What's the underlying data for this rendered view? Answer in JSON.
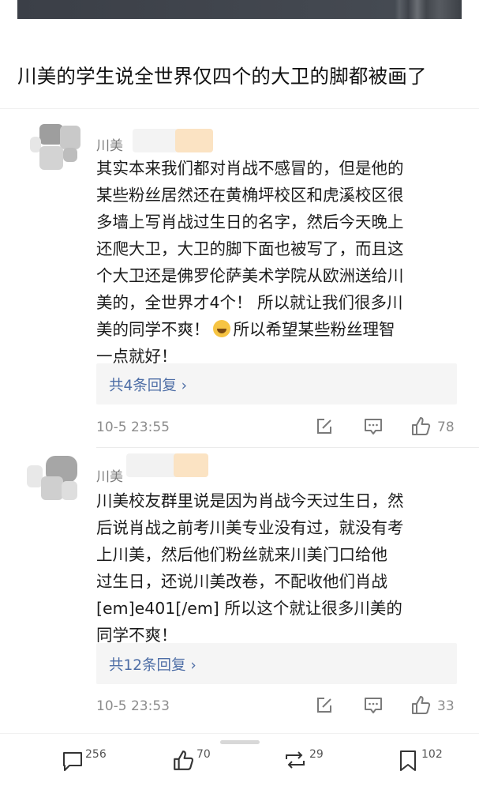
{
  "post": {
    "title": "川美的学生说全世界仅四个的大卫的脚都被画了"
  },
  "comments": [
    {
      "username": "川美",
      "lines": [
        "其实本来我们都对肖战不感冒的，但是他的",
        "某些粉丝居然还在黄桷坪校区和虎溪校区很",
        "多墙上写肖战过生日的名字，然后今天晚上",
        "还爬大卫，大卫的脚下面也被写了，而且这",
        "个大卫还是佛罗伦萨美术学院从欧洲送给川",
        "美的，全世界才4个！ 所以就让我们很多川",
        "美的同学不爽！",
        "所以希望某些粉丝理智",
        "一点就好！"
      ],
      "replies_label": "共4条回复 ›",
      "time": "10-5 23:55",
      "likes": "78",
      "emoji_icon": "laughing-tears-emoji"
    },
    {
      "username": "川美",
      "lines": [
        "川美校友群里说是因为肖战今天过生日，然",
        "后说肖战之前考川美专业没有过，就没有考",
        "上川美，然后他们粉丝就来川美门口给他",
        "过生日，还说川美改卷，不配收他们肖战",
        "[em]e401[/em] 所以这个就让很多川美的",
        "同学不爽！"
      ],
      "replies_label": "共12条回复 ›",
      "time": "10-5 23:53",
      "likes": "33"
    }
  ],
  "bottom_bar": {
    "comments": "256",
    "likes": "70",
    "reposts": "29",
    "favorites": "102"
  },
  "colors": {
    "link": "#4e6ea6",
    "meta_text": "#8c8c8c",
    "reply_bg": "#f5f5f5"
  },
  "icons": [
    "compose-icon",
    "chat-icon",
    "thumbs-up-icon",
    "repost-icon",
    "bookmark-icon"
  ]
}
